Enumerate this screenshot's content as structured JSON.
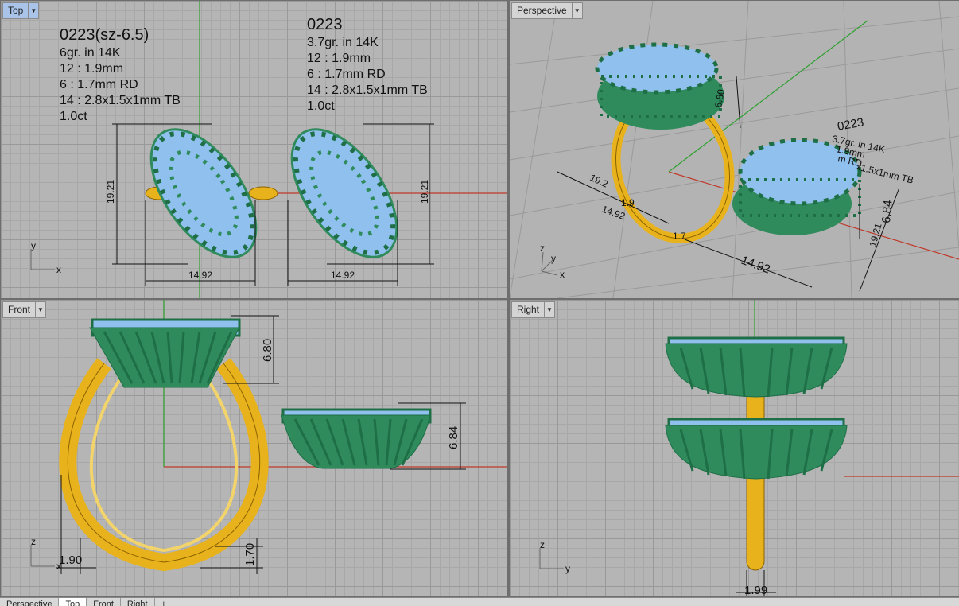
{
  "viewports": {
    "top": {
      "label": "Top"
    },
    "perspective": {
      "label": "Perspective"
    },
    "front": {
      "label": "Front"
    },
    "right": {
      "label": "Right"
    }
  },
  "top_notes": {
    "left": {
      "title": "0223(sz-6.5)",
      "lines": [
        "6gr.  in 14K",
        "12 : 1.9mm",
        "6 : 1.7mm RD",
        "14 : 2.8x1.5x1mm TB",
        "1.0ct"
      ]
    },
    "right": {
      "title": "0223",
      "lines": [
        "3.7gr.  in 14K",
        "12 : 1.9mm",
        "6 : 1.7mm RD",
        "14 : 2.8x1.5x1mm TB",
        "1.0ct"
      ]
    }
  },
  "dimensions": {
    "top_height_left": "19.21",
    "top_width_left": "14.92",
    "top_height_right": "19.21",
    "top_width_right": "14.92",
    "persp_height": "6.80",
    "persp_width_left": "14.92",
    "persp_small": "19.2",
    "persp_width_right": "14.92",
    "persp_height_right": "6.84",
    "persp_length_right": "19.21",
    "persp_label_a": "1.9",
    "persp_label_b": "1.7",
    "persp_note_1": "0223",
    "persp_note_2": "3.7gr.  in 14K",
    "persp_note_3": "1.9mm",
    "persp_note_4": "m RD",
    "persp_note_5": "x1.5x1mm TB",
    "front_height_left": "6.80",
    "front_height_right": "6.84",
    "front_shank": "1.90",
    "front_shank_h": "1.70",
    "right_shank": "1.99"
  },
  "axes": {
    "x": "x",
    "y": "y",
    "z": "z"
  },
  "bottom_tabs": [
    "Perspective",
    "Top",
    "Front",
    "Right",
    "+"
  ],
  "colors": {
    "gold": "#e8b21c",
    "green": "#2f8a5c",
    "stone": "#8fc0ee",
    "axis_red": "#c0392b",
    "axis_green": "#2ea02e"
  }
}
